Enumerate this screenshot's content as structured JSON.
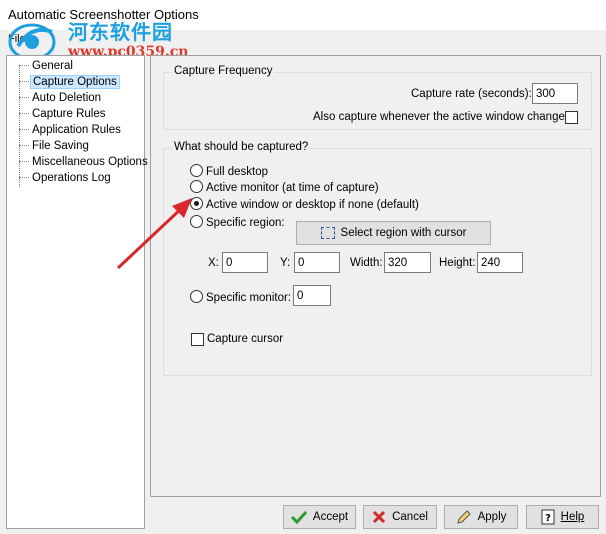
{
  "window": {
    "title": "Automatic Screenshotter Options"
  },
  "menu": {
    "file": "File"
  },
  "watermark": {
    "cn": "河东软件园",
    "url": "www.pc0359.cn"
  },
  "tree": {
    "items": [
      {
        "label": "General",
        "selected": false
      },
      {
        "label": "Capture Options",
        "selected": true
      },
      {
        "label": "Auto Deletion",
        "selected": false
      },
      {
        "label": "Capture Rules",
        "selected": false
      },
      {
        "label": "Application Rules",
        "selected": false
      },
      {
        "label": "File Saving",
        "selected": false
      },
      {
        "label": "Miscellaneous Options",
        "selected": false
      },
      {
        "label": "Operations Log",
        "selected": false
      }
    ]
  },
  "capture_frequency": {
    "legend": "Capture Frequency",
    "rate_label": "Capture rate (seconds):",
    "rate_value": "300",
    "window_change_label": "Also capture whenever the active window changes:",
    "window_change_checked": false
  },
  "what_captured": {
    "legend": "What should be captured?",
    "options": [
      {
        "label": "Full desktop",
        "checked": false
      },
      {
        "label": "Active monitor (at time of capture)",
        "checked": false
      },
      {
        "label": "Active window or desktop if none (default)",
        "checked": true
      },
      {
        "label": "Specific region:",
        "checked": false
      }
    ],
    "select_region_button": "Select region with cursor",
    "region": {
      "x_label": "X:",
      "x_value": "0",
      "y_label": "Y:",
      "y_value": "0",
      "width_label": "Width:",
      "width_value": "320",
      "height_label": "Height:",
      "height_value": "240"
    },
    "specific_monitor_label": "Specific monitor:",
    "specific_monitor_checked": false,
    "specific_monitor_value": "0",
    "capture_cursor_label": "Capture cursor",
    "capture_cursor_checked": false
  },
  "buttons": {
    "accept": "Accept",
    "cancel": "Cancel",
    "apply": "Apply",
    "help": "Help"
  },
  "colors": {
    "accent_selected": "#cce8ff",
    "annotation_arrow": "#d8262b"
  }
}
